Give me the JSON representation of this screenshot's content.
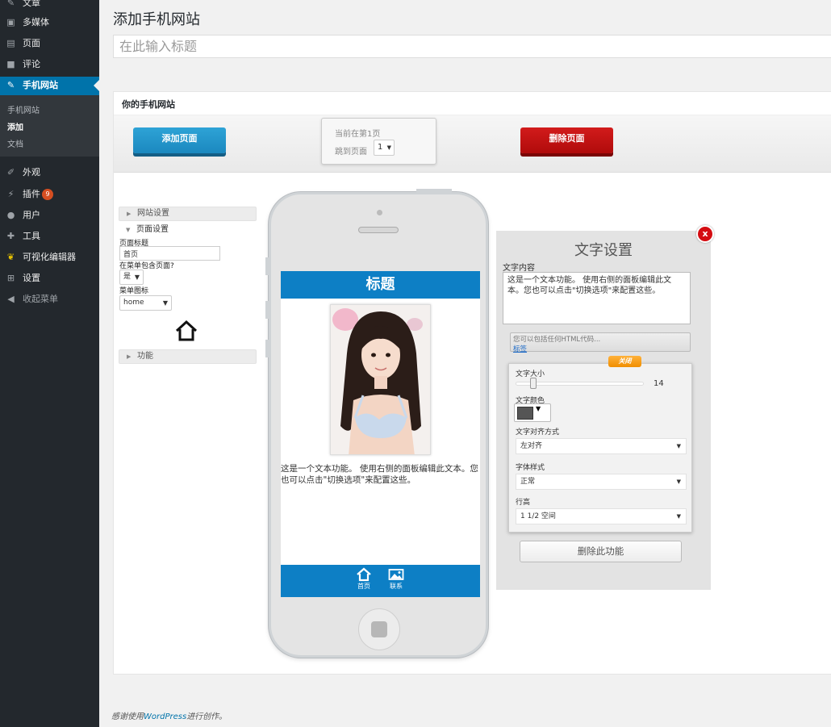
{
  "sidebar": {
    "items": [
      {
        "label": "文章",
        "icon": "pin-icon"
      },
      {
        "label": "多媒体",
        "icon": "media-icon"
      },
      {
        "label": "页面",
        "icon": "page-icon"
      },
      {
        "label": "评论",
        "icon": "comment-icon"
      },
      {
        "label": "手机网站",
        "icon": "pin-icon",
        "active": true
      },
      {
        "label": "外观",
        "icon": "brush-icon"
      },
      {
        "label": "插件",
        "icon": "plug-icon",
        "badge": "9"
      },
      {
        "label": "用户",
        "icon": "user-icon"
      },
      {
        "label": "工具",
        "icon": "wrench-icon"
      },
      {
        "label": "可视化编辑器",
        "icon": "editor-icon"
      },
      {
        "label": "设置",
        "icon": "settings-icon"
      },
      {
        "label": "收起菜单",
        "icon": "collapse-icon"
      }
    ],
    "submenu": [
      "手机网站",
      "添加",
      "文档"
    ],
    "accent_color": "#0073aa"
  },
  "header": {
    "title": "添加手机网站",
    "title_placeholder": "在此输入标题"
  },
  "panel": {
    "title": "你的手机网站",
    "add_page": "添加页面",
    "delete_page": "删除页面",
    "current_page": "当前在第1页",
    "jump_label": "跳到页面",
    "jump_value": "1"
  },
  "settings": {
    "site_settings": "网站设置",
    "page_settings": "页面设置",
    "page_title_label": "页面标题",
    "page_title_value": "首页",
    "in_menu_label": "在菜单包含页面?",
    "in_menu_value": "是",
    "menu_icon_label": "菜单图标",
    "menu_icon_value": "home",
    "functions": "功能"
  },
  "phone": {
    "header": "标题",
    "text": "这是一个文本功能。 使用右侧的面板编辑此文本。您也可以点击\"切换选项\"来配置这些。",
    "nav": [
      {
        "label": "首页",
        "icon": "home-icon"
      },
      {
        "label": "联系",
        "icon": "image-icon"
      }
    ],
    "header_color": "#0d7fc5"
  },
  "text_settings": {
    "title": "文字设置",
    "content_label": "文字内容",
    "content_value": "这是一个文本功能。 使用右侧的面板编辑此文本。您也可以点击\"切换选项\"来配置这些。",
    "html_hint": "您可以包括任何HTML代码...",
    "html_link": "标签",
    "toggle": "关闭",
    "size_label": "文字大小",
    "size_value": "14",
    "size_fraction": 0.14,
    "color_label": "文字颜色",
    "color_value": "#555555",
    "align_label": "文字对齐方式",
    "align_value": "左对齐",
    "style_label": "字体样式",
    "style_value": "正常",
    "line_height_label": "行高",
    "line_height_value": "1 1/2 空间",
    "delete_label": "删除此功能",
    "close_label": "x"
  },
  "footer": {
    "prefix": "感谢使用",
    "link": "WordPress",
    "suffix": "进行创作。"
  }
}
